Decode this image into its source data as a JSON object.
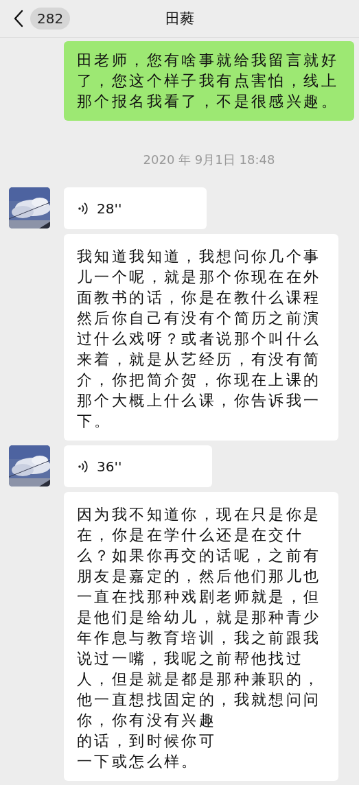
{
  "header": {
    "unread_count": "282",
    "title": "田蕤"
  },
  "messages": [
    {
      "kind": "text",
      "outgoing": true,
      "text": "田老师，您有啥事就给我留言就好了，您这个样子我有点害怕，线上那个报名我看了，不是很感兴趣。"
    },
    {
      "kind": "time",
      "text": "2020 年 9月1日 18:48"
    },
    {
      "kind": "voice",
      "outgoing": false,
      "duration": "28''"
    },
    {
      "kind": "text",
      "outgoing": false,
      "text": "我知道我知道，我想问你几个事儿一个呢，就是那个你现在在外面教书的话，你是在教什么课程然后你自己有没有个简历之前演过什么戏呀？或者说那个叫什么来着，就是从艺经历，有没有简介，你把简介贺，你现在上课的那个大概上什么课，你告诉我一下。"
    },
    {
      "kind": "voice",
      "outgoing": false,
      "duration": "36''"
    },
    {
      "kind": "text",
      "outgoing": false,
      "text": "因为我不知道你，现在只是你是在，你是在学什么还是在交什么？如果你再交的话呢，之前有朋友是嘉定的，然后他们那儿也一直在找那种戏剧老师就是，但是他们是给幼儿，就是那种青少年作息与教育培训，我之前跟我说过一嘴，我呢之前帮他找过人，但是就是都是那种兼职的，他一直想找固定的，我就想问问你，你有没有兴趣",
      "cut_lines": [
        "的话，到时候你可",
        "一下或怎么样。"
      ]
    }
  ]
}
